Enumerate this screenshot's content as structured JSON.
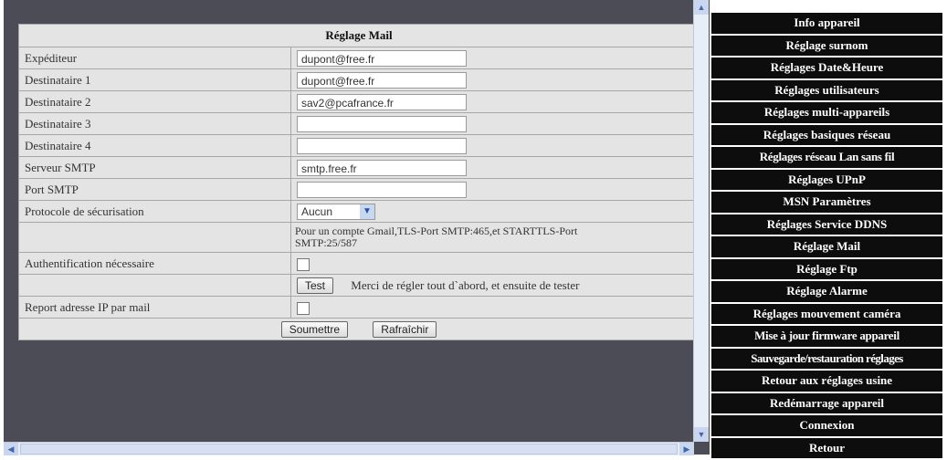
{
  "form": {
    "title": "Réglage Mail",
    "rows": [
      {
        "label": "Expéditeur",
        "value": "dupont@free.fr"
      },
      {
        "label": "Destinataire 1",
        "value": "dupont@free.fr"
      },
      {
        "label": "Destinataire 2",
        "value": "sav2@pcafrance.fr"
      },
      {
        "label": "Destinataire 3",
        "value": ""
      },
      {
        "label": "Destinataire 4",
        "value": ""
      },
      {
        "label": "Serveur SMTP",
        "value": "smtp.free.fr"
      },
      {
        "label": "Port SMTP",
        "value": ""
      }
    ],
    "protocol_label": "Protocole de sécurisation",
    "protocol_value": "Aucun",
    "protocol_note": "Pour un compte Gmail,TLS-Port SMTP:465,et STARTTLS-Port SMTP:25/587",
    "auth_label": "Authentification nécessaire",
    "test_button": "Test",
    "test_note": "Merci de régler tout d`abord, et ensuite de tester",
    "report_label": "Report adresse IP par mail",
    "submit_button": "Soumettre",
    "refresh_button": "Rafraîchir"
  },
  "menu": [
    "Info appareil",
    "Réglage surnom",
    "Réglages Date&Heure",
    "Réglages utilisateurs",
    "Réglages multi-appareils",
    "Réglages basiques réseau",
    "Réglages réseau Lan sans fil",
    "Réglages UPnP",
    "MSN Paramètres",
    "Réglages Service DDNS",
    "Réglage Mail",
    "Réglage Ftp",
    "Réglage Alarme",
    "Réglages mouvement caméra",
    "Mise à jour firmware appareil",
    "Sauvegarde/restauration réglages",
    "Retour aux réglages usine",
    "Redémarrage appareil",
    "Connexion",
    "Retour"
  ]
}
